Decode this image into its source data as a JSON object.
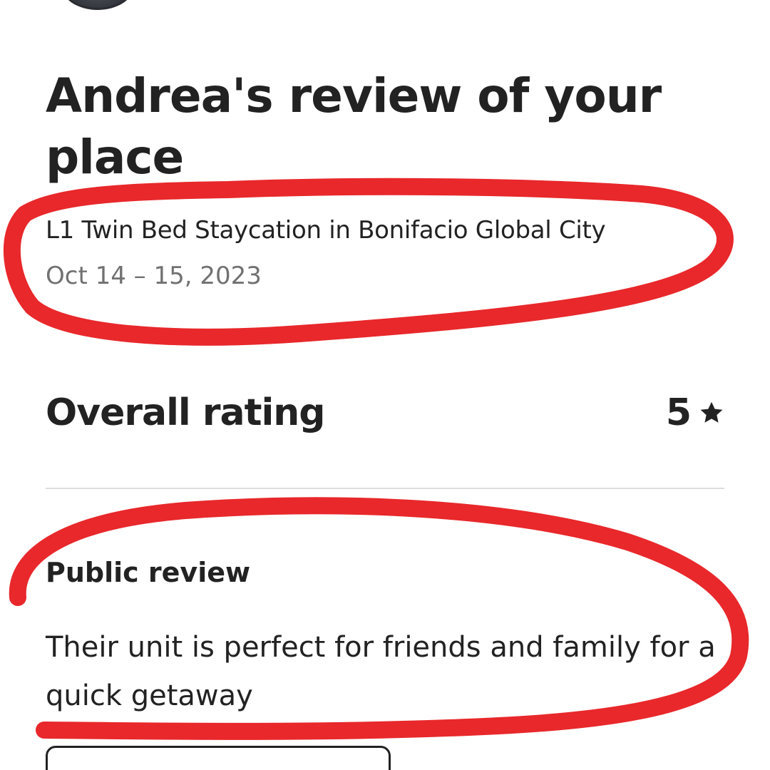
{
  "header": {
    "title": "Andrea's review of your place"
  },
  "listing": {
    "name": "L1 Twin Bed Staycation in Bonifacio Global City",
    "dates": "Oct 14 – 15, 2023"
  },
  "rating": {
    "label": "Overall rating",
    "value": "5",
    "icon": "star-icon"
  },
  "review": {
    "heading": "Public review",
    "text": "Their unit is perfect for friends and family for a quick getaway"
  },
  "annotations": {
    "color": "#e8282b"
  }
}
